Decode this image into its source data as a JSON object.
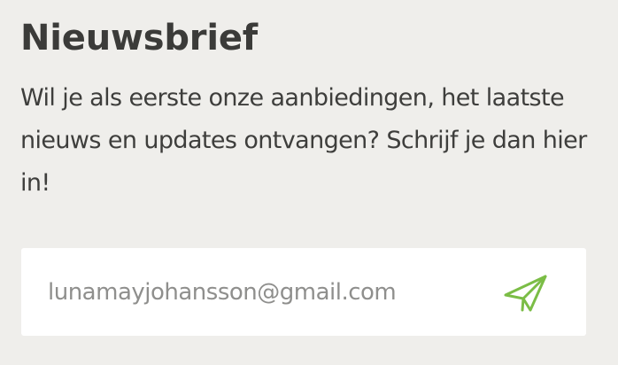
{
  "newsletter": {
    "title": "Nieuwsbrief",
    "description": "Wil je als eerste onze aanbiedingen, het laatste nieuws en updates ontvangen? Schrijf je dan hier in!",
    "email_value": "lunamayjohansson@gmail.com",
    "submit_icon": "paper-plane-icon",
    "accent_color": "#7bbd46"
  }
}
